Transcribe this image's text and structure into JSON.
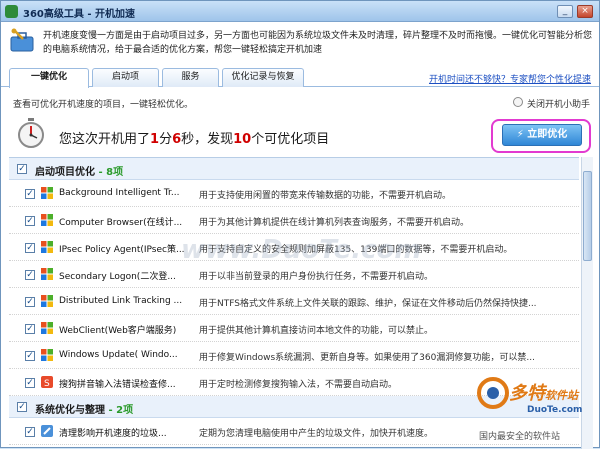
{
  "window": {
    "title": "360高级工具 - 开机加速",
    "min_label": "_",
    "close_label": "×"
  },
  "banner": {
    "description": "开机速度变慢一方面是由于启动项目过多，另一方面也可能因为系统垃圾文件未及时清理，碎片整理不及时而拖慢。一键优化可智能分析您的电脑系统情况，给于最合适的优化方案，帮您一键轻松搞定开机加速"
  },
  "tabs": [
    {
      "label": "一键优化"
    },
    {
      "label": "启动项"
    },
    {
      "label": "服务"
    },
    {
      "label": "优化记录与恢复"
    }
  ],
  "tab_link": "开机时间还不够快？专家帮您个性化提速",
  "info": {
    "text": "查看可优化开机速度的项目，一键轻松优化。",
    "helper_label": "关闭开机小助手"
  },
  "summary": {
    "prefix": "您这次开机用了",
    "minutes": "1",
    "min_unit": "分",
    "seconds": "6",
    "sec_unit": "秒，发现",
    "count": "10",
    "suffix": "个可优化项目",
    "button_label": "立即优化"
  },
  "groups": [
    {
      "title": "启动项目优化",
      "count": "- 8项"
    },
    {
      "title": "系统优化与整理",
      "count": "- 2项"
    }
  ],
  "startup_items": [
    {
      "name": "Background Intelligent Tr...",
      "desc": "用于支持使用闲置的带宽来传输数据的功能，不需要开机启动。"
    },
    {
      "name": "Computer Browser(在线计...",
      "desc": "用于为其他计算机提供在线计算机列表查询服务，不需要开机启动。"
    },
    {
      "name": "IPsec Policy Agent(IPsec策...",
      "desc": "用于支持自定义的安全规则加屏蔽135、139端口的数据等，不需要开机启动。"
    },
    {
      "name": "Secondary Logon(二次登...",
      "desc": "用于以非当前登录的用户身份执行任务，不需要开机启动。"
    },
    {
      "name": "Distributed Link Tracking ...",
      "desc": "用于NTFS格式文件系统上文件关联的跟踪、维护，保证在文件移动后仍然保持快捷..."
    },
    {
      "name": "WebClient(Web客户端服务)",
      "desc": "用于提供其他计算机直接访问本地文件的功能，可以禁止。"
    },
    {
      "name": "Windows Update( Windo...",
      "desc": "用于修复Windows系统漏洞、更新自身等。如果使用了360漏洞修复功能，可以禁..."
    },
    {
      "name": "搜狗拼音输入法错误检查修...",
      "desc": "用于定时检测修复搜狗输入法，不需要自动启动。"
    }
  ],
  "system_items": [
    {
      "name": "清理影响开机速度的垃圾...",
      "desc": "定期为您清理电脑使用中产生的垃圾文件，加快开机速度。"
    }
  ],
  "watermark": {
    "center": "www.DuoTe.com",
    "brand": "多特",
    "brand_suffix": "软件站",
    "brand_domain": "DuoTe.com",
    "tagline": "国内最安全的软件站"
  }
}
